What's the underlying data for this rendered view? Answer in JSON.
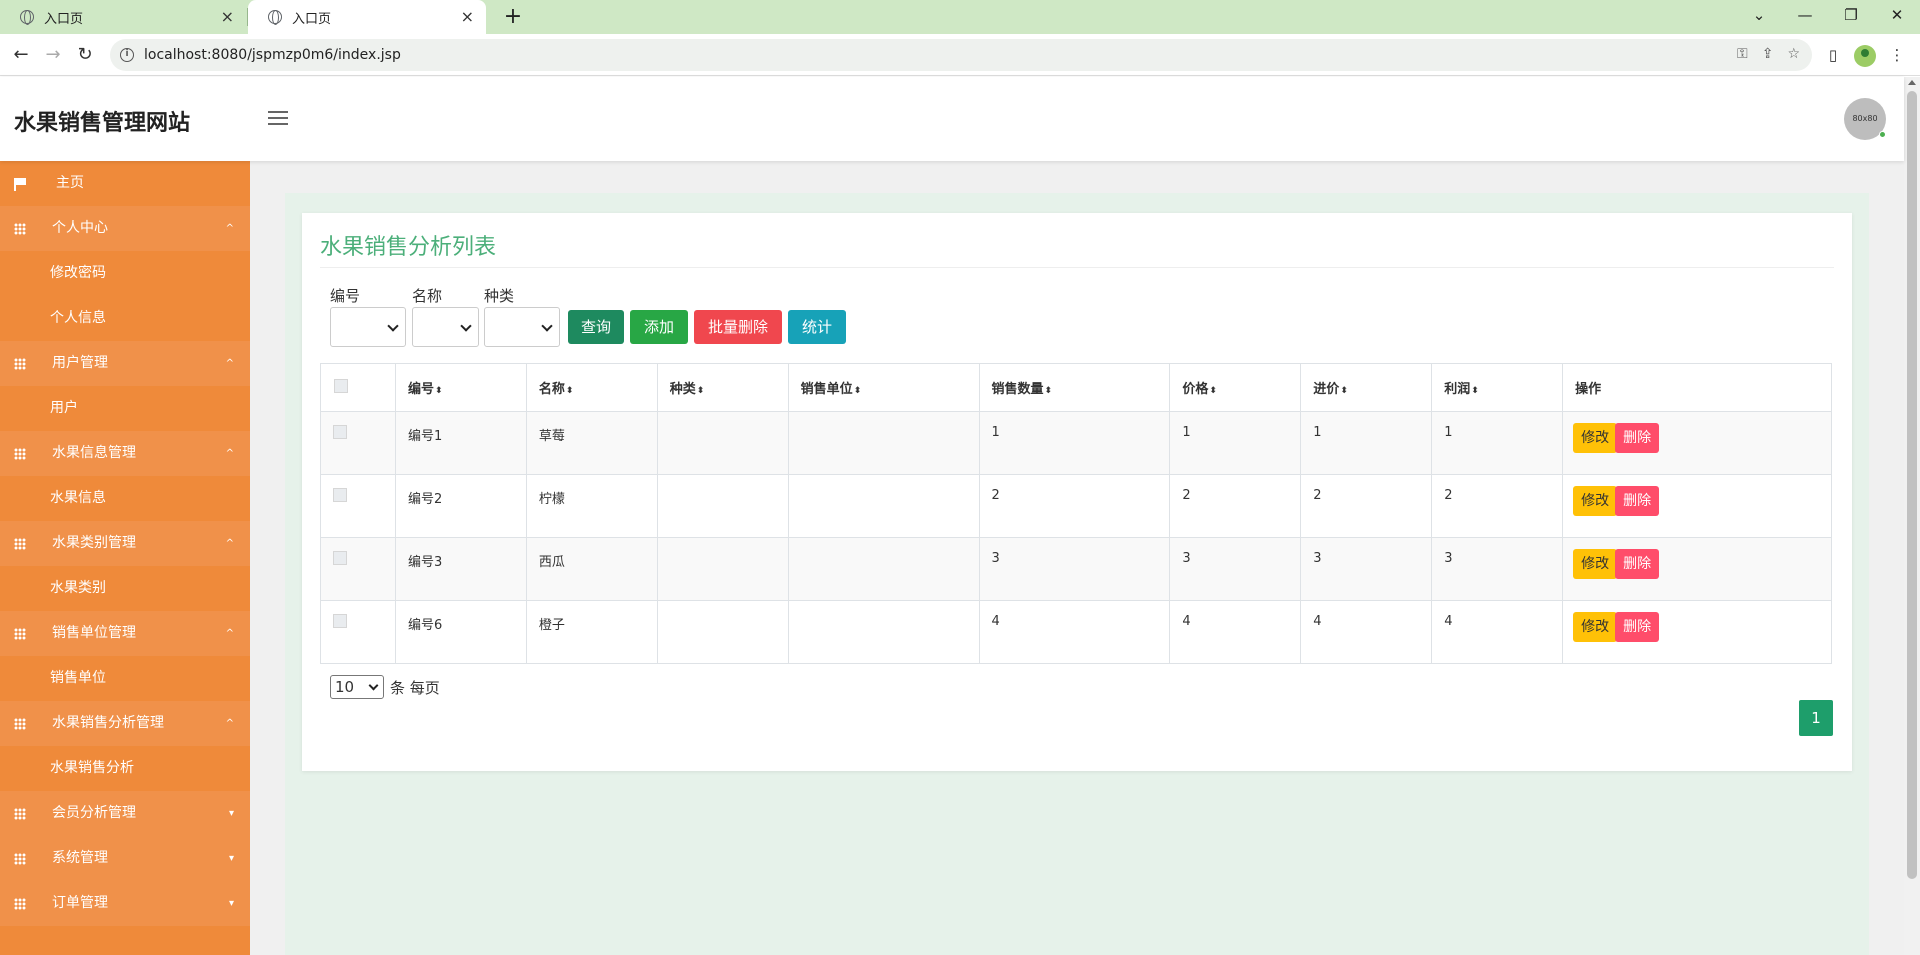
{
  "browser": {
    "tabs": [
      {
        "title": "入口页",
        "close": "×"
      },
      {
        "title": "入口页",
        "close": "×"
      }
    ],
    "new_tab": "+",
    "window_controls": {
      "dropdown": "⌄",
      "minimize": "—",
      "restore": "❐",
      "close": "✕"
    },
    "url": "localhost:8080/jspmzp0m6/index.jsp",
    "nav": {
      "back": "←",
      "forward": "→",
      "reload": "↻"
    },
    "url_icons": {
      "key": "⚿",
      "share": "⇪",
      "star": "☆"
    },
    "sidepanel": "▯",
    "menu": "⋮"
  },
  "header": {
    "brand": "水果销售管理网站",
    "avatar_text": "80x80"
  },
  "sidebar": {
    "items": [
      {
        "type": "home",
        "label": "主页",
        "icon": "flag-icon"
      },
      {
        "type": "group",
        "label": "个人中心",
        "icon": "grid-icon",
        "caret": "^"
      },
      {
        "type": "sub",
        "label": "修改密码"
      },
      {
        "type": "sub",
        "label": "个人信息"
      },
      {
        "type": "group",
        "label": "用户管理",
        "icon": "grid-icon",
        "caret": "^"
      },
      {
        "type": "sub",
        "label": "用户"
      },
      {
        "type": "group",
        "label": "水果信息管理",
        "icon": "grid-icon",
        "caret": "^"
      },
      {
        "type": "sub",
        "label": "水果信息"
      },
      {
        "type": "group",
        "label": "水果类别管理",
        "icon": "grid-icon",
        "caret": "^"
      },
      {
        "type": "sub",
        "label": "水果类别"
      },
      {
        "type": "group",
        "label": "销售单位管理",
        "icon": "grid-icon",
        "caret": "^"
      },
      {
        "type": "sub",
        "label": "销售单位"
      },
      {
        "type": "group",
        "label": "水果销售分析管理",
        "icon": "grid-icon",
        "caret": "^"
      },
      {
        "type": "sub",
        "label": "水果销售分析"
      },
      {
        "type": "group",
        "label": "会员分析管理",
        "icon": "grid-icon",
        "caret": "▾"
      },
      {
        "type": "group",
        "label": "系统管理",
        "icon": "grid-icon",
        "caret": "▾"
      },
      {
        "type": "group",
        "label": "订单管理",
        "icon": "grid-icon",
        "caret": "▾"
      }
    ]
  },
  "main": {
    "title": "水果销售分析列表",
    "filters": {
      "labels": [
        "编号",
        "名称",
        "种类"
      ]
    },
    "buttons": {
      "query": "查询",
      "add": "添加",
      "batch_delete": "批量删除",
      "stats": "统计"
    },
    "colors": {
      "query": "#1e8a5f",
      "add": "#28a745",
      "batch_delete": "#f0474e",
      "stats": "#17a2b8",
      "sidebar": "#ef8a3a",
      "title": "#4caf7a"
    },
    "table": {
      "columns": [
        "编号",
        "名称",
        "种类",
        "销售单位",
        "销售数量",
        "价格",
        "进价",
        "利润",
        "操作"
      ],
      "sort_glyph": "⬍",
      "rows": [
        {
          "id": "编号1",
          "name": "草莓",
          "kind": "",
          "unit": "",
          "qty": "1",
          "price": "1",
          "cost": "1",
          "profit": "1"
        },
        {
          "id": "编号2",
          "name": "柠檬",
          "kind": "",
          "unit": "",
          "qty": "2",
          "price": "2",
          "cost": "2",
          "profit": "2"
        },
        {
          "id": "编号3",
          "name": "西瓜",
          "kind": "",
          "unit": "",
          "qty": "3",
          "price": "3",
          "cost": "3",
          "profit": "3"
        },
        {
          "id": "编号6",
          "name": "橙子",
          "kind": "",
          "unit": "",
          "qty": "4",
          "price": "4",
          "cost": "4",
          "profit": "4"
        }
      ],
      "edit_label": "修改",
      "delete_label": "删除"
    },
    "pagination": {
      "page_size": "10",
      "page_size_suffix": "条 每页",
      "current_page": "1"
    }
  }
}
